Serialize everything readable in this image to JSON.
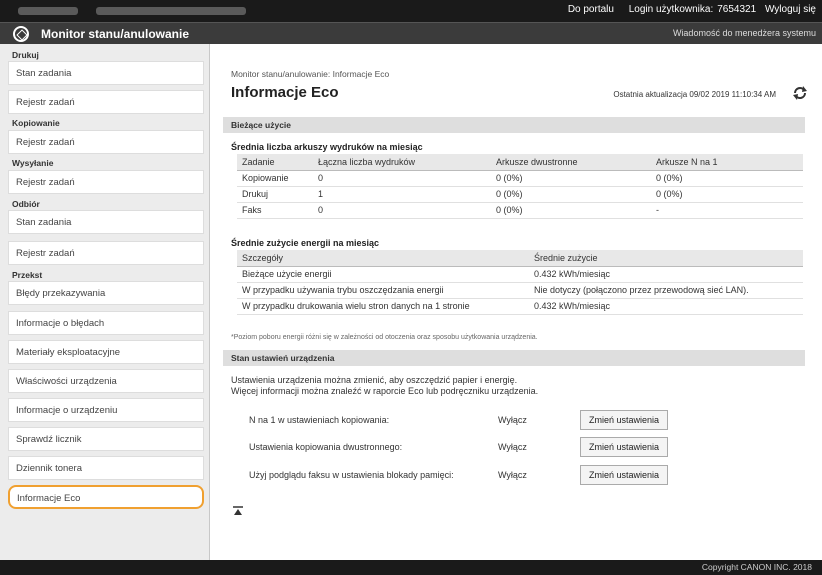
{
  "topbar": {
    "portal_link": "Do portalu",
    "login_label": "Login użytkownika:",
    "login_id": "7654321",
    "logout_link": "Wyloguj się"
  },
  "appbar": {
    "title": "Monitor stanu/anulowanie",
    "admin_message": "Wiadomość do menedżera systemu"
  },
  "sidebar": {
    "categories": {
      "print": "Drukuj",
      "copy": "Kopiowanie",
      "send": "Wysyłanie",
      "receive": "Odbiór",
      "device": "Przekst"
    },
    "items": {
      "print_status": "Stan zadania",
      "print_log": "Rejestr zadań",
      "copy_log": "Rejestr zadań",
      "send_log": "Rejestr zadań",
      "recv_status": "Stan zadania",
      "recv_log": "Rejestr zadań",
      "errors": "Błędy przekazywania",
      "error_info": "Informacje o błędach",
      "consumables": "Materiały eksploatacyjne",
      "properties": "Właściwości urządzenia",
      "device_info": "Informacje o urządzeniu",
      "counter": "Sprawdź licznik",
      "toner_log": "Dziennik tonera",
      "eco": "Informacje Eco"
    }
  },
  "main": {
    "breadcrumb": "Monitor stanu/anulowanie: Informacje Eco",
    "title": "Informacje Eco",
    "last_update": "Ostatnia aktualizacja 09/02 2019 11:10:34 AM",
    "current_usage": {
      "section": "Bieżące użycie",
      "prints_heading": "Średnia liczba arkuszy wydruków na miesiąc",
      "prints_headers": [
        "Zadanie",
        "Łączna liczba wydruków",
        "Arkusze dwustronne",
        "Arkusze N na 1"
      ],
      "prints_rows": [
        [
          "Kopiowanie",
          "0",
          "0 (0%)",
          "0 (0%)"
        ],
        [
          "Drukuj",
          "1",
          "0 (0%)",
          "0 (0%)"
        ],
        [
          "Faks",
          "0",
          "0 (0%)",
          "-"
        ]
      ],
      "energy_heading": "Średnie zużycie energii na miesiąc",
      "energy_headers": [
        "Szczegóły",
        "Średnie zużycie"
      ],
      "energy_rows": [
        [
          "Bieżące użycie energii",
          "0.432 kWh/miesiąc"
        ],
        [
          "W przypadku używania trybu oszczędzania energii",
          "Nie dotyczy (połączono przez przewodową sieć LAN)."
        ],
        [
          "W przypadku drukowania wielu stron danych na 1 stronie",
          "0.432 kWh/miesiąc"
        ]
      ],
      "note": "*Poziom poboru energii różni się w zależności od otoczenia oraz sposobu użytkowania urządzenia."
    },
    "settings": {
      "section": "Stan ustawień urządzenia",
      "para_line1": "Ustawienia urządzenia można zmienić, aby oszczędzić papier i energię.",
      "para_line2": "Więcej informacji można znaleźć w raporcie Eco lub podręczniku urządzenia.",
      "rows": [
        {
          "label": "N na 1 w ustawieniach kopiowania:",
          "value": "Wyłącz",
          "button": "Zmień ustawienia"
        },
        {
          "label": "Ustawienia kopiowania dwustronnego:",
          "value": "Wyłącz",
          "button": "Zmień ustawienia"
        },
        {
          "label": "Użyj podglądu faksu w ustawienia blokady pamięci:",
          "value": "Wyłącz",
          "button": "Zmień ustawienia"
        }
      ]
    }
  },
  "footer": {
    "copyright": "Copyright CANON INC. 2018"
  },
  "colors": {
    "selected_outline": "#f0a030",
    "header_bar": "#1a1a1a"
  }
}
